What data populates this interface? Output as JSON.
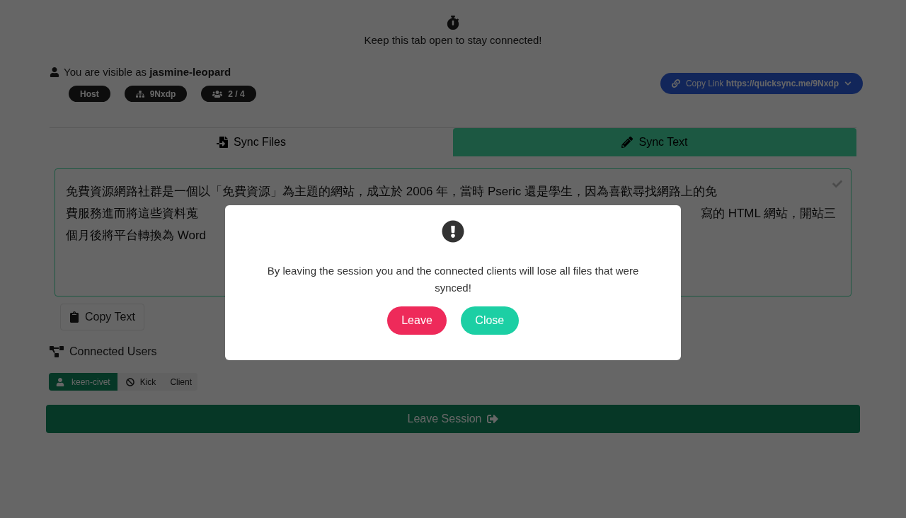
{
  "notice": "Keep this tab open to stay connected!",
  "identity": "You are visible as **jasmine-leopard**",
  "badges": [
    {
      "kind": "role",
      "label": "Host"
    },
    {
      "kind": "room",
      "label": "9Nxdp"
    },
    {
      "kind": "count",
      "label": "2 / 4"
    }
  ],
  "copy_link": "Copy Link **https://quicksync.me/9Nxdp**",
  "tabs": [
    {
      "label": "Sync Files",
      "kind": "files",
      "selected": false
    },
    {
      "label": "Sync Text",
      "kind": "text",
      "selected": true
    }
  ],
  "text_area": {
    "lines": [
      {
        "left": "免費資源網路社群是一個以「免費資源」為主題的網站，成立於 2006 年，當時 Pseric 還是學生，因為喜歡尋找網路上的免"
      },
      {
        "left": "費服務進而將這些資料蒐",
        "right": "寫的 HTML 網站，開站三"
      },
      {
        "left": "個月後將平台轉換為 Word"
      }
    ]
  },
  "copy_text": "Copy Text",
  "connected_users": {
    "title": "Connected Users",
    "users": [
      {
        "name": "keen-civet",
        "action": "Kick",
        "role": "Client"
      }
    ]
  },
  "leave_session": "Leave Session",
  "dialog": {
    "message": "By leaving the session you and the connected clients will lose all files that were synced!",
    "buttons": [
      {
        "label": "Leave",
        "kind": "danger"
      },
      {
        "label": "Close",
        "kind": "secondary"
      }
    ]
  }
}
